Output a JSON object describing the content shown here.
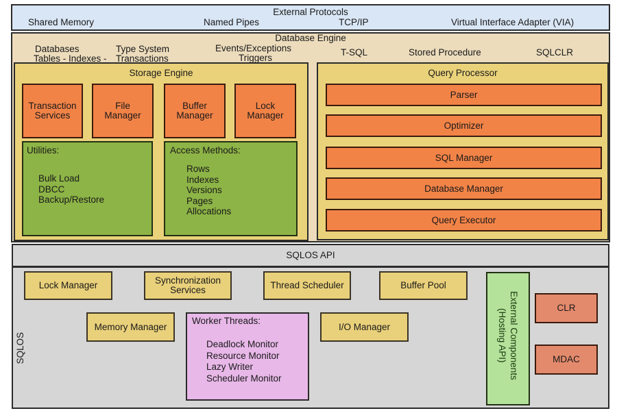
{
  "external_protocols": {
    "title": "External Protocols",
    "items": [
      "Shared Memory",
      "Named Pipes",
      "TCP/IP",
      "Virtual Interface Adapter (VIA)"
    ]
  },
  "database_engine": {
    "title": "Database Engine",
    "labels": {
      "databases": "Databases",
      "tables_indexes": "Tables - Indexes -",
      "type_system": "Type System",
      "transactions": "Transactions",
      "events_exceptions": "Events/Exceptions",
      "triggers": "Triggers",
      "tsql": "T-SQL",
      "stored_procedure": "Stored Procedure",
      "sqlclr": "SQLCLR"
    },
    "storage_engine": {
      "title": "Storage Engine",
      "components": [
        {
          "line1": "Transaction",
          "line2": "Services"
        },
        {
          "line1": "File",
          "line2": "Manager"
        },
        {
          "line1": "Buffer",
          "line2": "Manager"
        },
        {
          "line1": "Lock",
          "line2": "Manager"
        }
      ],
      "utilities": {
        "title": "Utilities:",
        "items": [
          "Bulk Load",
          "DBCC",
          "Backup/Restore"
        ]
      },
      "access_methods": {
        "title": "Access Methods:",
        "items": [
          "Rows",
          "Indexes",
          "Versions",
          "Pages",
          "Allocations"
        ]
      }
    },
    "query_processor": {
      "title": "Query Processor",
      "components": [
        "Parser",
        "Optimizer",
        "SQL Manager",
        "Database Manager",
        "Query Executor"
      ]
    }
  },
  "sqlos_api": {
    "title": "SQLOS API"
  },
  "sqlos": {
    "label": "SQLOS",
    "lock_manager": "Lock Manager",
    "sync_services": {
      "line1": "Synchronization",
      "line2": "Services"
    },
    "thread_scheduler": "Thread Scheduler",
    "buffer_pool": "Buffer Pool",
    "memory_manager": "Memory Manager",
    "worker_threads": {
      "title": "Worker Threads:",
      "items": [
        "Deadlock Monitor",
        "Resource Monitor",
        "Lazy Writer",
        "Scheduler Monitor"
      ]
    },
    "io_manager": "I/O Manager",
    "external_components": {
      "line1": "External Components",
      "line2": "(Hosting API)"
    },
    "clr": "CLR",
    "mdac": "MDAC"
  },
  "colors": {
    "protocols_bg": "#d9e6f5",
    "engine_bg": "#ecdcbc",
    "subsystem_bg": "#ead27a",
    "component_orange": "#f28347",
    "component_green": "#8db446",
    "sqlos_bg": "#d6d6d6",
    "worker_threads_bg": "#e8b8e8",
    "external_components_bg": "#b4e29a",
    "clr_mdac_bg": "#e48a6c"
  }
}
